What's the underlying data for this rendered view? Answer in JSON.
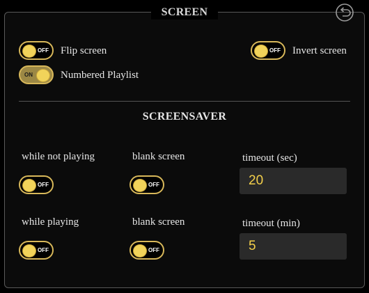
{
  "screen": {
    "title": "SCREEN",
    "flip_screen": {
      "label": "Flip screen",
      "state": "OFF"
    },
    "invert_screen": {
      "label": "Invert screen",
      "state": "OFF"
    },
    "numbered_playlist": {
      "label": "Numbered Playlist",
      "state": "ON"
    }
  },
  "screensaver": {
    "title": "SCREENSAVER",
    "while_not_playing": {
      "label": "while not playing",
      "state": "OFF",
      "blank_label": "blank screen",
      "blank_state": "OFF",
      "timeout_label": "timeout (sec)",
      "timeout_value": "20"
    },
    "while_playing": {
      "label": "while playing",
      "state": "OFF",
      "blank_label": "blank screen",
      "blank_state": "OFF",
      "timeout_label": "timeout (min)",
      "timeout_value": "5"
    }
  },
  "icons": {
    "back": "back-arrow-icon"
  },
  "colors": {
    "accent": "#f1d35a",
    "toggle_border": "#d8b85a",
    "toggle_on_bg": "#9c8845",
    "input_bg": "#2a2a2a",
    "input_text": "#f3cf4a"
  }
}
